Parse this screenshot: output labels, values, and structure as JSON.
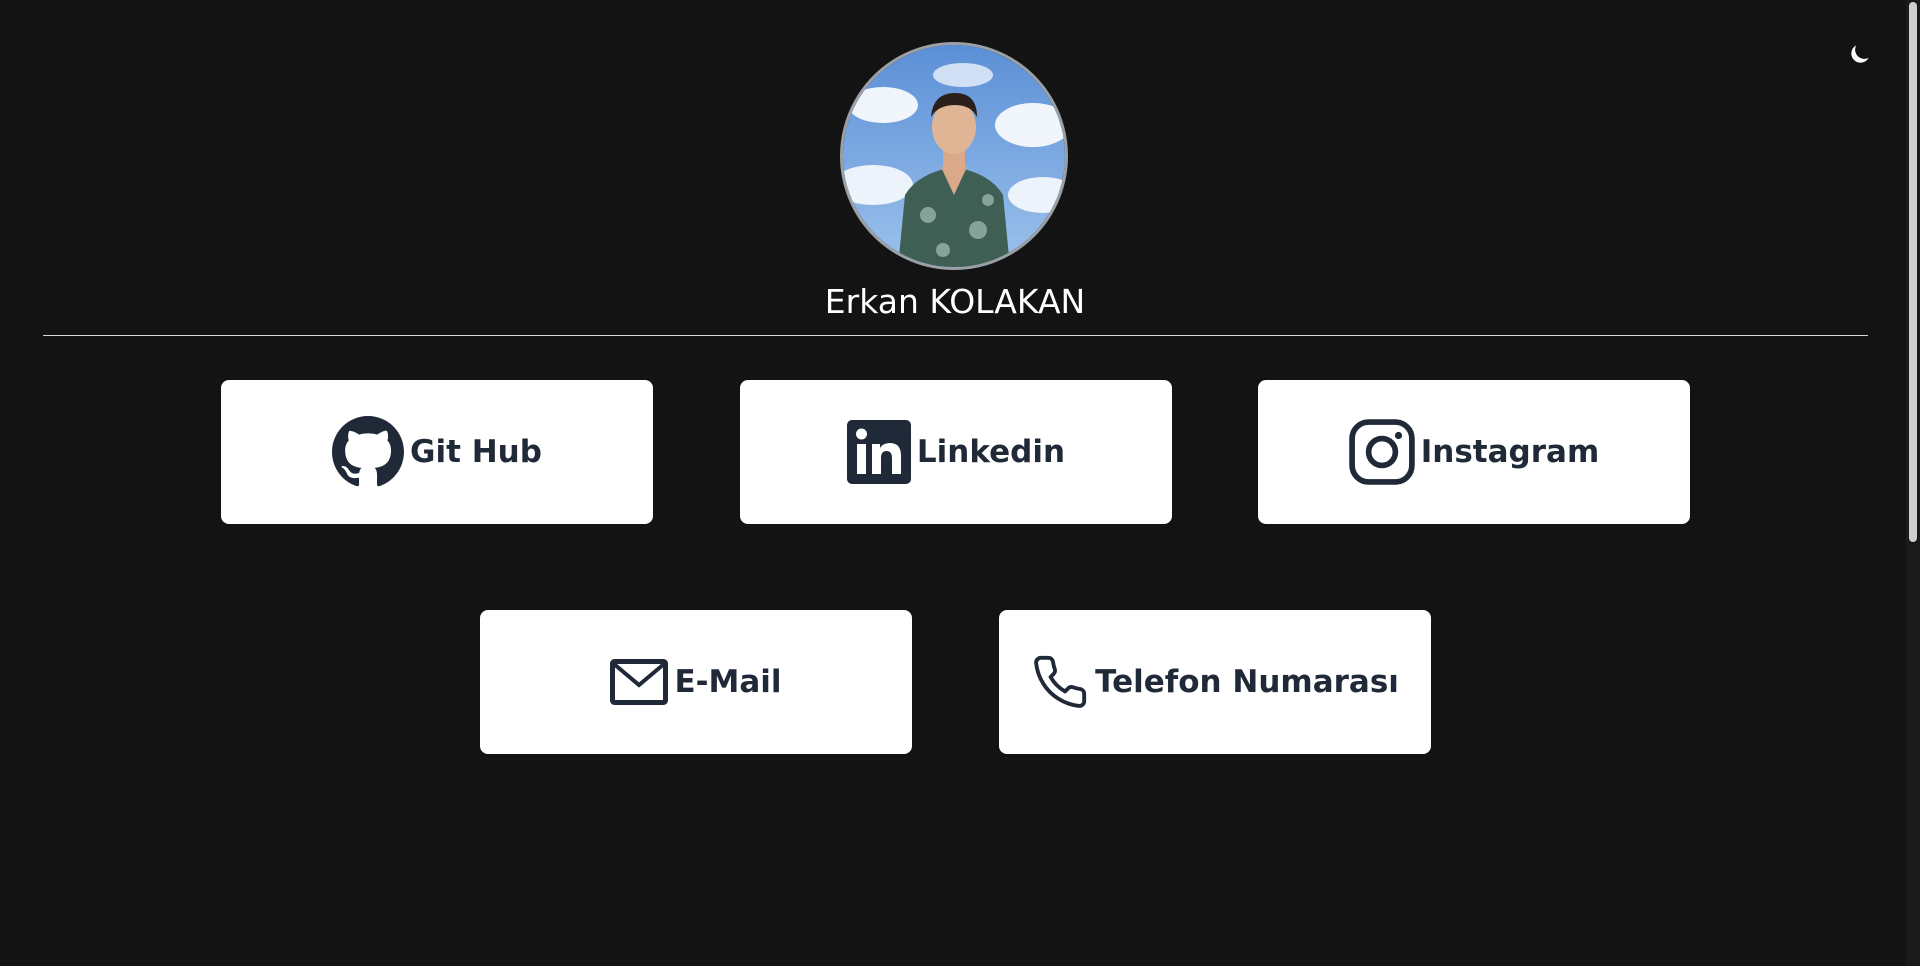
{
  "profile": {
    "name": "Erkan KOLAKAN",
    "avatar_icon": "profile-photo"
  },
  "theme_toggle": {
    "icon": "moon-icon"
  },
  "links": [
    {
      "label": "Git Hub",
      "icon": "github-icon"
    },
    {
      "label": "Linkedin",
      "icon": "linkedin-icon"
    },
    {
      "label": "Instagram",
      "icon": "instagram-icon"
    },
    {
      "label": "E-Mail",
      "icon": "mail-icon"
    },
    {
      "label": "Telefon Numarası",
      "icon": "phone-icon"
    }
  ],
  "colors": {
    "background": "#131313",
    "card_background": "#ffffff",
    "card_text": "#1f2937",
    "name_text": "#ffffff"
  }
}
